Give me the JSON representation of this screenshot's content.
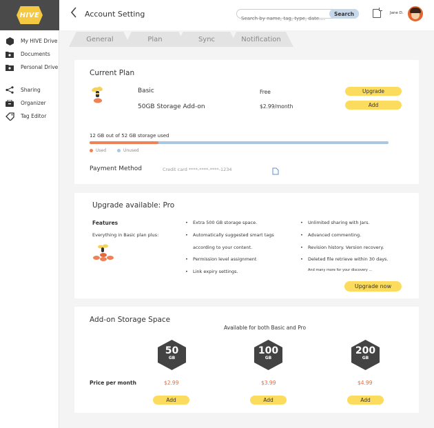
{
  "app": {
    "logo_text": "HIVE",
    "brand_color": "#f5c842"
  },
  "sidebar": {
    "items": [
      {
        "label": "My HIVE Drive",
        "icon": "hexagon-icon"
      },
      {
        "label": "Documents",
        "icon": "folder-icon"
      },
      {
        "label": "Personal Drive",
        "icon": "folder-icon"
      },
      {
        "label": "Sharing",
        "icon": "share-icon"
      },
      {
        "label": "Organizer",
        "icon": "organizer-icon"
      },
      {
        "label": "Tag Editor",
        "icon": "tag-icon"
      }
    ]
  },
  "header": {
    "title": "Account Setting",
    "search_placeholder": "Search by name, tag, type, date....",
    "search_label": "Search",
    "user_name": "Jane D."
  },
  "tabs": [
    {
      "label": "General",
      "active": false
    },
    {
      "label": "Plan",
      "active": true
    },
    {
      "label": "Sync",
      "active": false
    },
    {
      "label": "Notification",
      "active": false
    }
  ],
  "current_plan": {
    "title": "Current Plan",
    "rows": [
      {
        "name": "Basic",
        "price": "Free",
        "action": "Upgrade"
      },
      {
        "name": "50GB Storage Add-on",
        "price": "$2.99/month",
        "action": "Add"
      }
    ],
    "storage_text": "12 GB out of 52 GB storage used",
    "used_fraction": 0.23,
    "legend_used": "Used",
    "legend_unused": "Unused",
    "used_color": "#ee8256",
    "unused_color": "#aac6e2",
    "payment_label": "Payment Method",
    "payment_value": "Credit card ****-****-****-1234"
  },
  "upgrade": {
    "title": "Upgrade available: Pro",
    "features_label": "Features",
    "features_sub": "Everything in Basic plan plus:",
    "col1": [
      "Extra 500 GB storage space.",
      "Automatically suggested smart tags",
      "according to your content.",
      "Permission level assignment",
      "Link expiry settings."
    ],
    "col2": [
      "Unlimited sharing with Jars.",
      "Advanced commenting.",
      "Revision history. Version recovery.",
      "Deleted file retrieve within 30 days."
    ],
    "more_text": "And many more for your discovery ...",
    "button": "Upgrade now"
  },
  "addon": {
    "title": "Add-on Storage Space",
    "subtitle": "Available for both Basic and Pro",
    "price_label": "Price per month",
    "unit": "GB",
    "options": [
      {
        "size": "50",
        "price": "$2.99",
        "action": "Add"
      },
      {
        "size": "100",
        "price": "$3.99",
        "action": "Add"
      },
      {
        "size": "200",
        "price": "$4.99",
        "action": "Add"
      }
    ]
  }
}
